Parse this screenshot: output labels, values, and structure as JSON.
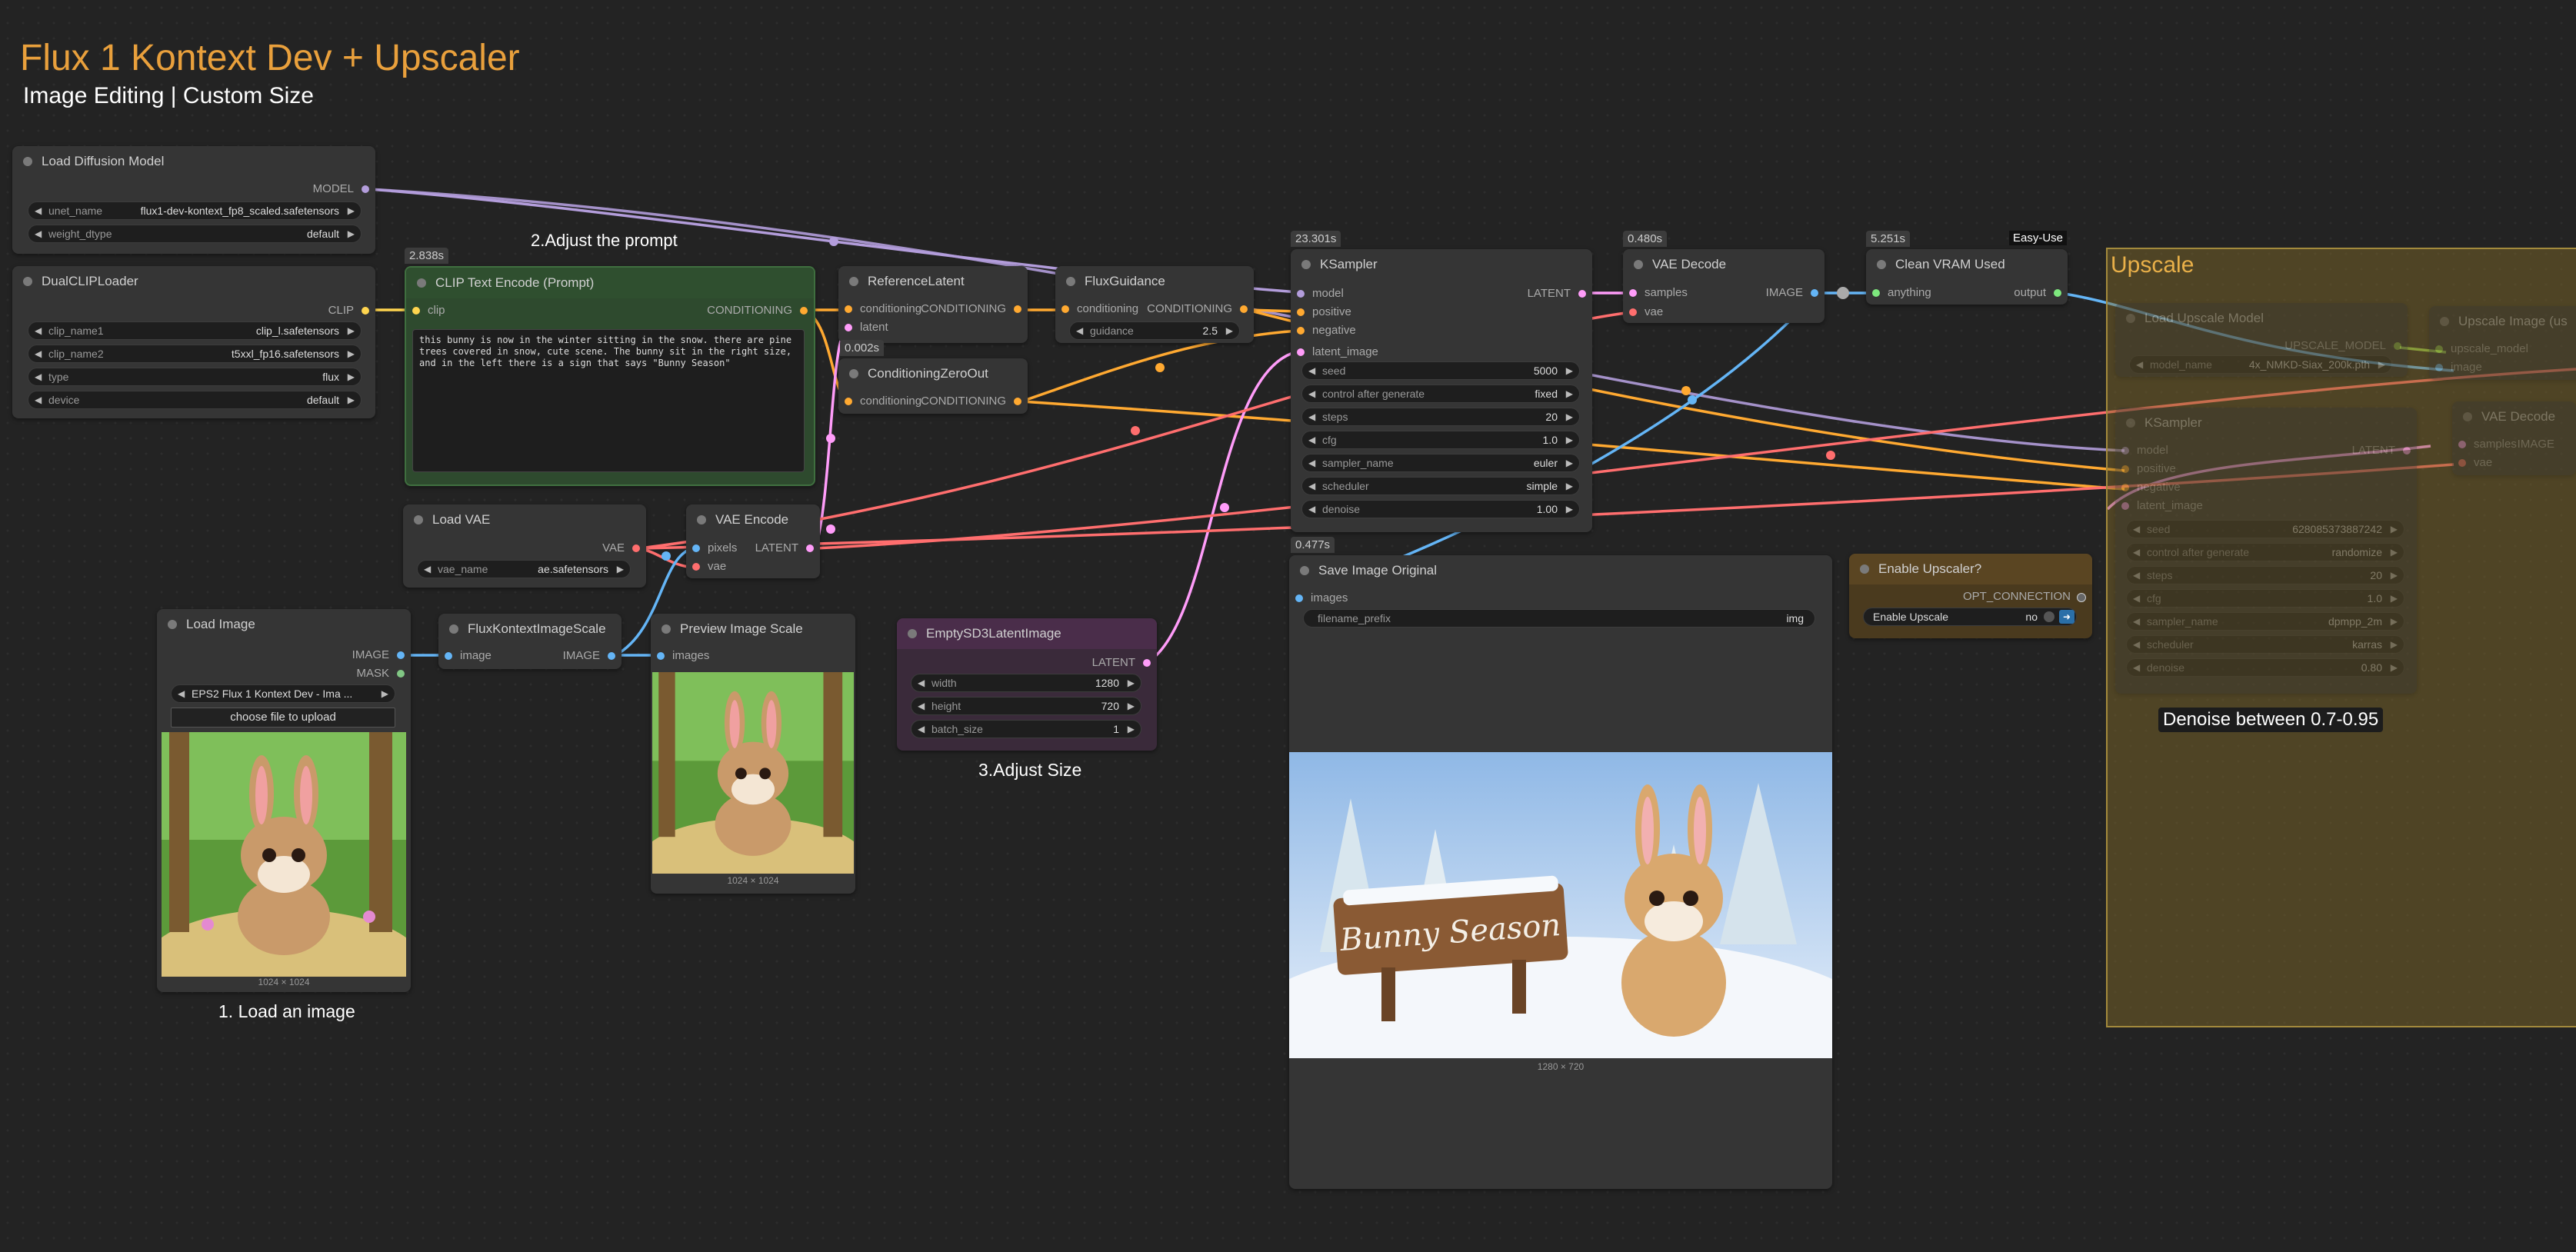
{
  "header": {
    "title": "Flux 1 Kontext Dev + Upscaler",
    "subtitle": "Image Editing | Custom Size"
  },
  "colors": {
    "title": "#e9a03c",
    "model_wire": "#b39ddb",
    "clip_wire": "#ffd54f",
    "conditioning_wire": "#ffa931",
    "latent_wire": "#ff9cf9",
    "vae_wire": "#ff6e6e",
    "image_wire": "#64b5f6",
    "group_fill": "#846c28"
  },
  "annotations": {
    "step1": "1. Load an image",
    "step2": "2.Adjust the prompt",
    "step3": "3.Adjust Size",
    "denoise_note": "Denoise between 0.7-0.95",
    "easy_use_badge": "Easy-Use"
  },
  "nodes": {
    "load_diffusion": {
      "title": "Load Diffusion Model",
      "out": "MODEL",
      "widgets": [
        {
          "name": "unet_name",
          "value": "flux1-dev-kontext_fp8_scaled.safetensors"
        },
        {
          "name": "weight_dtype",
          "value": "default"
        }
      ]
    },
    "dual_clip": {
      "title": "DualCLIPLoader",
      "out": "CLIP",
      "widgets": [
        {
          "name": "clip_name1",
          "value": "clip_l.safetensors"
        },
        {
          "name": "clip_name2",
          "value": "t5xxl_fp16.safetensors"
        },
        {
          "name": "type",
          "value": "flux"
        },
        {
          "name": "device",
          "value": "default"
        }
      ]
    },
    "clip_encode": {
      "timing": "2.838s",
      "title": "CLIP Text Encode (Prompt)",
      "in": "clip",
      "out": "CONDITIONING",
      "prompt": "this bunny is now in the winter sitting in the snow. there are pine trees covered in snow, cute scene. The bunny sit in the right size, and in the left there is a sign that says \"Bunny Season\""
    },
    "reference_latent": {
      "title": "ReferenceLatent",
      "in1": "conditioning",
      "in2": "latent",
      "out": "CONDITIONING"
    },
    "cond_zero": {
      "timing": "0.002s",
      "title": "ConditioningZeroOut",
      "in": "conditioning",
      "out": "CONDITIONING"
    },
    "flux_guidance": {
      "title": "FluxGuidance",
      "in": "conditioning",
      "out": "CONDITIONING",
      "widget": {
        "name": "guidance",
        "value": "2.5"
      }
    },
    "ksampler": {
      "timing": "23.301s",
      "title": "KSampler",
      "inputs": [
        "model",
        "positive",
        "negative",
        "latent_image"
      ],
      "out": "LATENT",
      "widgets": [
        {
          "name": "seed",
          "value": "5000"
        },
        {
          "name": "control after generate",
          "value": "fixed"
        },
        {
          "name": "steps",
          "value": "20"
        },
        {
          "name": "cfg",
          "value": "1.0"
        },
        {
          "name": "sampler_name",
          "value": "euler"
        },
        {
          "name": "scheduler",
          "value": "simple"
        },
        {
          "name": "denoise",
          "value": "1.00"
        }
      ]
    },
    "vae_decode": {
      "timing": "0.480s",
      "title": "VAE Decode",
      "in1": "samples",
      "in2": "vae",
      "out": "IMAGE"
    },
    "clean_vram": {
      "timing": "5.251s",
      "title": "Clean VRAM Used",
      "in": "anything",
      "out": "output"
    },
    "load_vae": {
      "title": "Load VAE",
      "out": "VAE",
      "widget": {
        "name": "vae_name",
        "value": "ae.safetensors"
      }
    },
    "vae_encode": {
      "title": "VAE Encode",
      "in1": "pixels",
      "in2": "vae",
      "out": "LATENT"
    },
    "load_image": {
      "title": "Load Image",
      "out1": "IMAGE",
      "out2": "MASK",
      "file": "EPS2 Flux 1 Kontext Dev - Ima ...",
      "upload_label": "choose file to upload",
      "caption": "1024 × 1024"
    },
    "kontext_scale": {
      "title": "FluxKontextImageScale",
      "in": "image",
      "out": "IMAGE"
    },
    "preview_scale": {
      "title": "Preview Image Scale",
      "in": "images",
      "caption": "1024 × 1024"
    },
    "empty_latent": {
      "title": "EmptySD3LatentImage",
      "out": "LATENT",
      "widgets": [
        {
          "name": "width",
          "value": "1280"
        },
        {
          "name": "height",
          "value": "720"
        },
        {
          "name": "batch_size",
          "value": "1"
        }
      ]
    },
    "save_image": {
      "timing": "0.477s",
      "title": "Save Image Original",
      "in": "images",
      "widget": {
        "name": "filename_prefix",
        "value": "img"
      },
      "sign_text": "Bunny Season",
      "caption": "1280 × 720"
    },
    "enable_upscaler": {
      "title": "Enable Upscaler?",
      "out": "OPT_CONNECTION",
      "widget": {
        "name": "Enable Upscale",
        "value": "no"
      }
    }
  },
  "upscale_group": {
    "title": "Upscale",
    "load_upscale": {
      "title": "Load Upscale Model",
      "out": "UPSCALE_MODEL",
      "widget": {
        "name": "model_name",
        "value": "4x_NMKD-Siax_200k.pth"
      }
    },
    "upscale_image": {
      "title": "Upscale Image (us",
      "in1": "upscale_model",
      "in2": "image"
    },
    "ksampler2": {
      "title": "KSampler",
      "inputs": [
        "model",
        "positive",
        "negative",
        "latent_image"
      ],
      "out": "LATENT",
      "widgets": [
        {
          "name": "seed",
          "value": "628085373887242"
        },
        {
          "name": "control after generate",
          "value": "randomize"
        },
        {
          "name": "steps",
          "value": "20"
        },
        {
          "name": "cfg",
          "value": "1.0"
        },
        {
          "name": "sampler_name",
          "value": "dpmpp_2m"
        },
        {
          "name": "scheduler",
          "value": "karras"
        },
        {
          "name": "denoise",
          "value": "0.80"
        }
      ]
    },
    "vae_decode2": {
      "title": "VAE Decode",
      "in1": "samples",
      "in2": "vae",
      "out": "IMAGE"
    }
  }
}
